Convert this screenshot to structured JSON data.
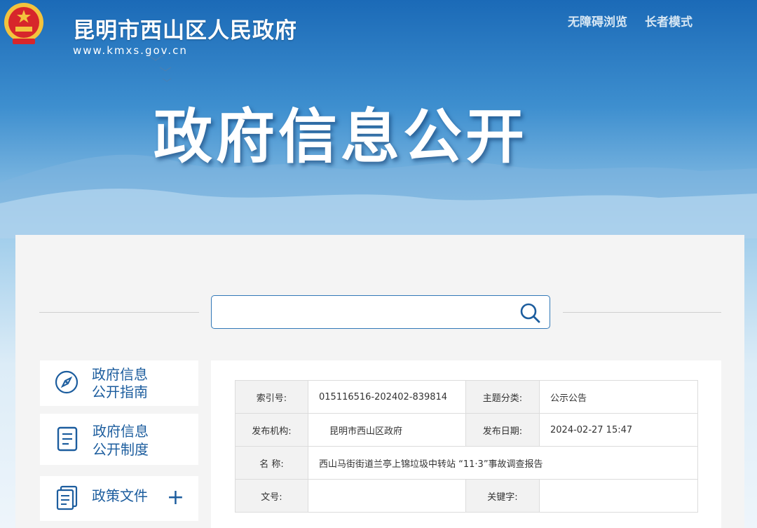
{
  "header": {
    "site_name": "昆明市西山区人民政府",
    "site_url": "www.kmxs.gov.cn",
    "accessibility_link": "无障碍浏览",
    "elder_mode_link": "长者模式",
    "banner_title": "政府信息公开"
  },
  "search": {
    "placeholder": "",
    "value": ""
  },
  "sidebar": {
    "items": [
      {
        "line1": "政府信息",
        "line2": "公开指南",
        "icon": "compass-icon"
      },
      {
        "line1": "政府信息",
        "line2": "公开制度",
        "icon": "document-icon"
      },
      {
        "line1": "政策文件",
        "icon": "files-icon",
        "expand": "+"
      }
    ]
  },
  "info": {
    "rows": [
      {
        "k1": "索引号:",
        "v1": "015116516-202402-839814",
        "k2": "主题分类:",
        "v2": "公示公告"
      },
      {
        "k1": "发布机构:",
        "v1": "昆明市西山区政府",
        "k2": "发布日期:",
        "v2": "2024-02-27 15:47"
      },
      {
        "k1": "名 称:",
        "v1": "西山马街街道兰亭上锦垃圾中转站 “11·3”事故调查报告"
      },
      {
        "k1": "文号:",
        "v1": "",
        "k2": "关键字:",
        "v2": ""
      }
    ]
  },
  "colors": {
    "primary": "#1c5d9e",
    "banner_top": "#1f73bd",
    "emblem_red": "#d7262b",
    "emblem_gold": "#f3c33d"
  }
}
